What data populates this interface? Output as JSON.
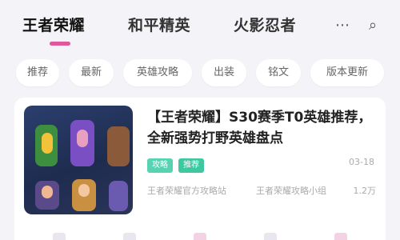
{
  "top_tabs": [
    {
      "label": "王者荣耀",
      "active": true
    },
    {
      "label": "和平精英",
      "active": false
    },
    {
      "label": "火影忍者",
      "active": false
    }
  ],
  "top_icons": {
    "more": "⋯",
    "search": "⌕"
  },
  "chips": [
    "推荐",
    "最新",
    "英雄攻略",
    "出装",
    "铭文",
    "版本更新"
  ],
  "card": {
    "title": "【王者荣耀】S30赛季T0英雄推荐，全新强势打野英雄盘点",
    "tags": [
      "攻略",
      "推荐"
    ],
    "date": "03-18",
    "meta": [
      "王者荣耀官方攻略站",
      "王者荣耀攻略小组",
      "1.2万"
    ]
  },
  "colors": {
    "accent": "#e0589a",
    "tag": "#56d3b2",
    "background": "#f4f3f7"
  }
}
